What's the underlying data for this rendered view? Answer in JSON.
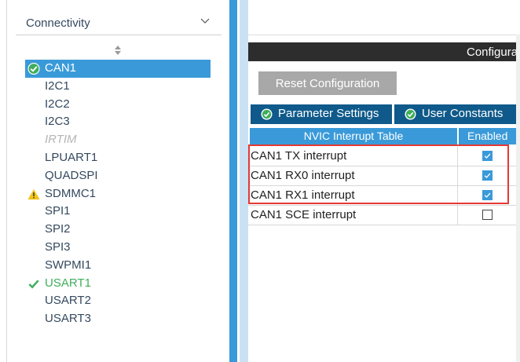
{
  "sidebar": {
    "category_title": "Connectivity",
    "items": [
      {
        "label": "CAN1",
        "status": "ok",
        "selected": true
      },
      {
        "label": "I2C1",
        "status": "none"
      },
      {
        "label": "I2C2",
        "status": "none"
      },
      {
        "label": "I2C3",
        "status": "none"
      },
      {
        "label": "IRTIM",
        "status": "disabled"
      },
      {
        "label": "LPUART1",
        "status": "none"
      },
      {
        "label": "QUADSPI",
        "status": "none"
      },
      {
        "label": "SDMMC1",
        "status": "warning"
      },
      {
        "label": "SPI1",
        "status": "none"
      },
      {
        "label": "SPI2",
        "status": "none"
      },
      {
        "label": "SPI3",
        "status": "none"
      },
      {
        "label": "SWPMI1",
        "status": "none"
      },
      {
        "label": "USART1",
        "status": "ok-text"
      },
      {
        "label": "USART2",
        "status": "none"
      },
      {
        "label": "USART3",
        "status": "none"
      }
    ]
  },
  "config": {
    "title": "Configura",
    "reset_label": "Reset Configuration",
    "tabs": [
      {
        "label": "Parameter Settings",
        "icon": "check-circle-icon"
      },
      {
        "label": "User Constants",
        "icon": "check-circle-icon"
      }
    ]
  },
  "nvic": {
    "col_name": "NVIC Interrupt Table",
    "col_enabled": "Enabled",
    "rows": [
      {
        "name": "CAN1 TX interrupt",
        "enabled": true
      },
      {
        "name": "CAN1 RX0 interrupt",
        "enabled": true
      },
      {
        "name": "CAN1 RX1 interrupt",
        "enabled": true
      },
      {
        "name": "CAN1 SCE interrupt",
        "enabled": false
      }
    ]
  },
  "colors": {
    "accent": "#3a9ad9",
    "tab_bg": "#0f5a8a",
    "ok": "#3fae5c",
    "warning": "#f2c318",
    "highlight": "#e53935"
  }
}
